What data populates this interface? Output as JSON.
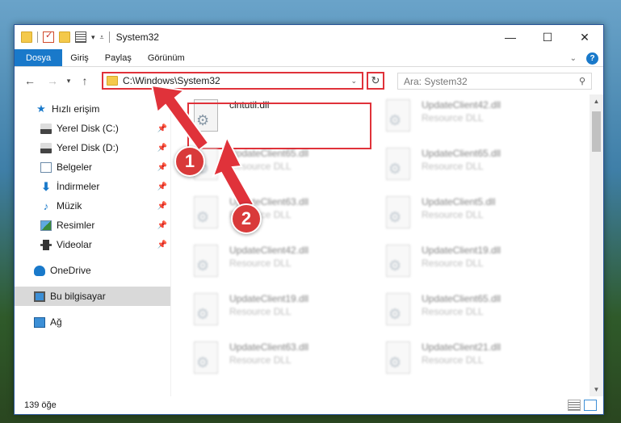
{
  "window": {
    "title": "System32"
  },
  "ribbon": {
    "tabs": [
      "Dosya",
      "Giriş",
      "Paylaş",
      "Görünüm"
    ],
    "help_label": "?"
  },
  "titlebar": {
    "minimize_glyph": "—",
    "maximize_glyph": "☐",
    "close_glyph": "✕"
  },
  "navbar": {
    "back_glyph": "←",
    "forward_glyph": "→",
    "recent_glyph": "▾",
    "up_glyph": "↑",
    "address_path": "C:\\Windows\\System32",
    "refresh_glyph": "↻",
    "search_placeholder": "Ara: System32"
  },
  "sidebar": {
    "items": [
      {
        "label": "Hızlı erişim",
        "icon": "star-icon",
        "pinned": false
      },
      {
        "label": "Yerel Disk (C:)",
        "icon": "drive-icon",
        "pinned": true
      },
      {
        "label": "Yerel Disk (D:)",
        "icon": "drive-icon",
        "pinned": true
      },
      {
        "label": "Belgeler",
        "icon": "documents-icon",
        "pinned": true
      },
      {
        "label": "İndirmeler",
        "icon": "downloads-icon",
        "pinned": true
      },
      {
        "label": "Müzik",
        "icon": "music-icon",
        "pinned": true
      },
      {
        "label": "Resimler",
        "icon": "pictures-icon",
        "pinned": true
      },
      {
        "label": "Videolar",
        "icon": "videos-icon",
        "pinned": true
      },
      {
        "label": "OneDrive",
        "icon": "onedrive-icon",
        "pinned": false
      },
      {
        "label": "Bu bilgisayar",
        "icon": "this-pc-icon",
        "pinned": false,
        "selected": true
      },
      {
        "label": "Ağ",
        "icon": "network-icon",
        "pinned": false
      }
    ]
  },
  "files": [
    {
      "name": "clntutil.dll",
      "type": "",
      "highlighted": true
    },
    {
      "name": "UpdateClient42.dll",
      "type": "Resource DLL"
    },
    {
      "name": "UpdateClient65.dll",
      "type": "Resource DLL"
    },
    {
      "name": "UpdateClient65.dll",
      "type": "Resource DLL"
    },
    {
      "name": "UpdateClient63.dll",
      "type": "Resource DLL"
    },
    {
      "name": "UpdateClient5.dll",
      "type": "Resource DLL"
    },
    {
      "name": "UpdateClient42.dll",
      "type": "Resource DLL"
    },
    {
      "name": "UpdateClient19.dll",
      "type": "Resource DLL"
    },
    {
      "name": "UpdateClient19.dll",
      "type": "Resource DLL"
    },
    {
      "name": "UpdateClient65.dll",
      "type": "Resource DLL"
    },
    {
      "name": "UpdateClient63.dll",
      "type": "Resource DLL"
    },
    {
      "name": "UpdateClient21.dll",
      "type": "Resource DLL"
    }
  ],
  "status": {
    "item_count": "139 öğe"
  },
  "markers": [
    "1",
    "2"
  ],
  "colors": {
    "accent": "#1979ca",
    "highlight": "#e0323a"
  }
}
